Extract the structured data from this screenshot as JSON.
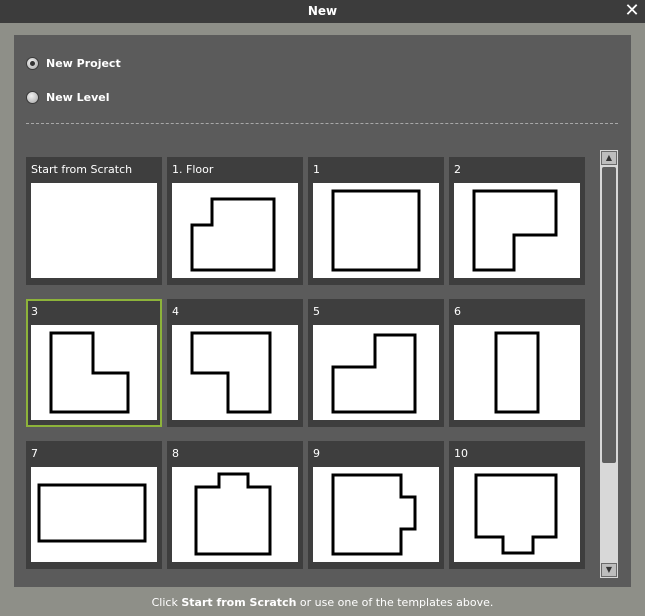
{
  "window": {
    "title": "New",
    "close_glyph": "✕"
  },
  "options": [
    {
      "label": "New Project",
      "checked": true
    },
    {
      "label": "New Level",
      "checked": false
    }
  ],
  "templates": [
    {
      "label": "Start from Scratch",
      "shape": "blank"
    },
    {
      "label": "1. Floor",
      "shape": "step-left"
    },
    {
      "label": "1",
      "shape": "square"
    },
    {
      "label": "2",
      "shape": "l-top-right"
    },
    {
      "label": "3",
      "shape": "l-bottom-right",
      "selected": true
    },
    {
      "label": "4",
      "shape": "l-top-left"
    },
    {
      "label": "5",
      "shape": "step-left-2"
    },
    {
      "label": "6",
      "shape": "tall-rect"
    },
    {
      "label": "7",
      "shape": "wide-rect"
    },
    {
      "label": "8",
      "shape": "bump-top"
    },
    {
      "label": "9",
      "shape": "bump-right"
    },
    {
      "label": "10",
      "shape": "bump-bottom"
    }
  ],
  "selection_color": "#8db33a",
  "footer": {
    "prefix": "Click ",
    "bold": "Start from Scratch",
    "suffix": " or use one of the templates above."
  }
}
